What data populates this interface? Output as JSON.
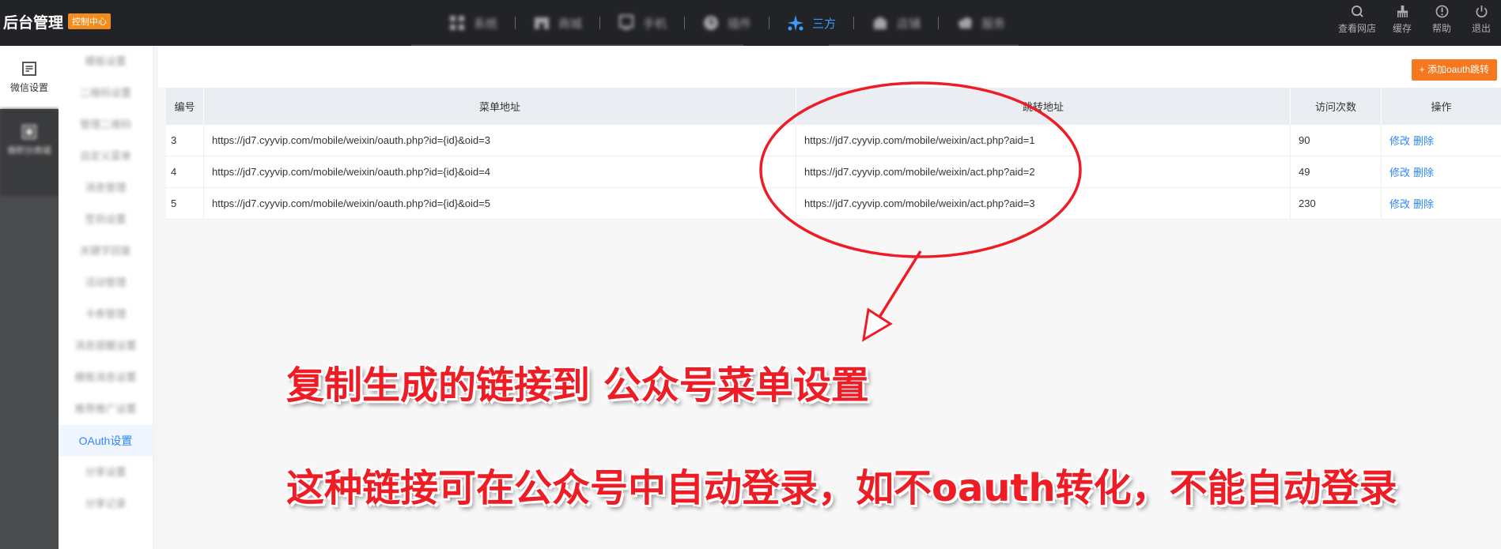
{
  "header": {
    "app_title": "后台管理",
    "badge": "控制中心",
    "nav": [
      {
        "label": "系统",
        "icon": "grid-icon",
        "blurred": true
      },
      {
        "label": "商城",
        "icon": "store-icon",
        "blurred": true
      },
      {
        "label": "手机",
        "icon": "monitor-icon",
        "blurred": true
      },
      {
        "label": "插件",
        "icon": "clock-icon",
        "blurred": true
      },
      {
        "label": "三方",
        "icon": "sparkle-icon",
        "active": true
      },
      {
        "label": "店铺",
        "icon": "shop-icon",
        "blurred": true
      },
      {
        "label": "服务",
        "icon": "cloud-icon",
        "blurred": true
      }
    ],
    "right_actions": [
      {
        "label": "查看网店",
        "icon": "search-icon"
      },
      {
        "label": "缓存",
        "icon": "broom-icon"
      },
      {
        "label": "帮助",
        "icon": "info-icon"
      },
      {
        "label": "退出",
        "icon": "power-icon"
      }
    ]
  },
  "rail": {
    "items": [
      {
        "label": "微信设置",
        "icon": "wechat-settings-icon",
        "active": true
      },
      {
        "label": "微积分商城",
        "icon": "box-icon"
      }
    ]
  },
  "submenu": {
    "items": [
      {
        "label": "模板设置",
        "blurred": true
      },
      {
        "label": "二维码设置",
        "blurred": true
      },
      {
        "label": "管理二维码",
        "blurred": true
      },
      {
        "label": "自定义菜单",
        "blurred": true
      },
      {
        "label": "消息管理",
        "blurred": true
      },
      {
        "label": "签到设置",
        "blurred": true
      },
      {
        "label": "关键字回复",
        "blurred": true
      },
      {
        "label": "活动管理",
        "blurred": true
      },
      {
        "label": "卡券管理",
        "blurred": true
      },
      {
        "label": "消息提醒设置",
        "blurred": true
      },
      {
        "label": "模板消息设置",
        "blurred": true
      },
      {
        "label": "推荐推广设置",
        "blurred": true
      },
      {
        "label": "OAuth设置",
        "active": true
      },
      {
        "label": "分享设置",
        "blurred": true
      },
      {
        "label": "分享记录",
        "blurred": true
      }
    ]
  },
  "toolbar": {
    "add_button": "+ 添加oauth跳转"
  },
  "table": {
    "headers": [
      "编号",
      "菜单地址",
      "跳转地址",
      "访问次数",
      "操作"
    ],
    "rows": [
      {
        "id": "3",
        "menu_url": "https://jd7.cyyvip.com/mobile/weixin/oauth.php?id={id}&oid=3",
        "redirect_url": "https://jd7.cyyvip.com/mobile/weixin/act.php?aid=1",
        "visits": "90",
        "edit": "修改",
        "delete": "删除"
      },
      {
        "id": "4",
        "menu_url": "https://jd7.cyyvip.com/mobile/weixin/oauth.php?id={id}&oid=4",
        "redirect_url": "https://jd7.cyyvip.com/mobile/weixin/act.php?aid=2",
        "visits": "49",
        "edit": "修改",
        "delete": "删除"
      },
      {
        "id": "5",
        "menu_url": "https://jd7.cyyvip.com/mobile/weixin/oauth.php?id={id}&oid=5",
        "redirect_url": "https://jd7.cyyvip.com/mobile/weixin/act.php?aid=3",
        "visits": "230",
        "edit": "修改",
        "delete": "删除"
      }
    ]
  },
  "annotation": {
    "line1": "复制生成的链接到  公众号菜单设置",
    "line2": "这种链接可在公众号中自动登录，如不oauth转化，不能自动登录",
    "color": "#ee1c25"
  }
}
